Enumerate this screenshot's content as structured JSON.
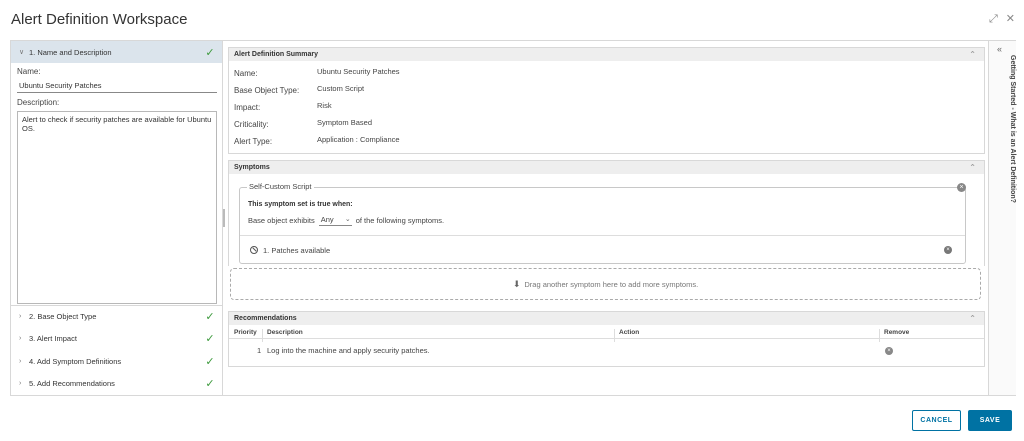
{
  "window": {
    "title": "Alert Definition Workspace",
    "expand_icon": "expand-icon",
    "close_icon": "close-icon"
  },
  "steps": [
    {
      "label": "1. Name and Description",
      "completed": true,
      "expanded": true
    },
    {
      "label": "2. Base Object Type",
      "completed": true,
      "expanded": false
    },
    {
      "label": "3. Alert Impact",
      "completed": true,
      "expanded": false
    },
    {
      "label": "4. Add Symptom Definitions",
      "completed": true,
      "expanded": false
    },
    {
      "label": "5. Add Recommendations",
      "completed": true,
      "expanded": false
    }
  ],
  "name_description": {
    "name_label": "Name:",
    "name_value": "Ubuntu Security Patches",
    "description_label": "Description:",
    "description_value": "Alert to check if security patches are available for Ubuntu OS."
  },
  "summary": {
    "header": "Alert Definition Summary",
    "rows": [
      {
        "label": "Name:",
        "value": "Ubuntu Security Patches"
      },
      {
        "label": "Base Object Type:",
        "value": "Custom Script"
      },
      {
        "label": "Impact:",
        "value": "Risk"
      },
      {
        "label": "Criticality:",
        "value": "Symptom Based"
      },
      {
        "label": "Alert Type:",
        "value": "Application : Compliance"
      }
    ]
  },
  "symptoms": {
    "header": "Symptoms",
    "set_title": "Self-Custom Script",
    "condition_heading": "This symptom set is true when:",
    "exhibits_prefix": "Base object exhibits",
    "exhibits_value": "Any",
    "exhibits_suffix": "of the following symptoms.",
    "items": [
      {
        "label": "1. Patches available"
      }
    ],
    "dropzone_text": "Drag another symptom here to add more symptoms."
  },
  "recommendations": {
    "header": "Recommendations",
    "columns": [
      "Priority",
      "Description",
      "Action",
      "Remove"
    ],
    "rows": [
      {
        "priority": "1",
        "description": "Log into the machine and apply security patches.",
        "action": ""
      }
    ]
  },
  "side_panel": {
    "label": "Getting Started - What is an Alert Definition?"
  },
  "footer": {
    "cancel_label": "CANCEL",
    "save_label": "SAVE"
  },
  "colors": {
    "accent": "#0072a3",
    "check": "#3d9a3d",
    "active_step": "#dbe4ec"
  }
}
